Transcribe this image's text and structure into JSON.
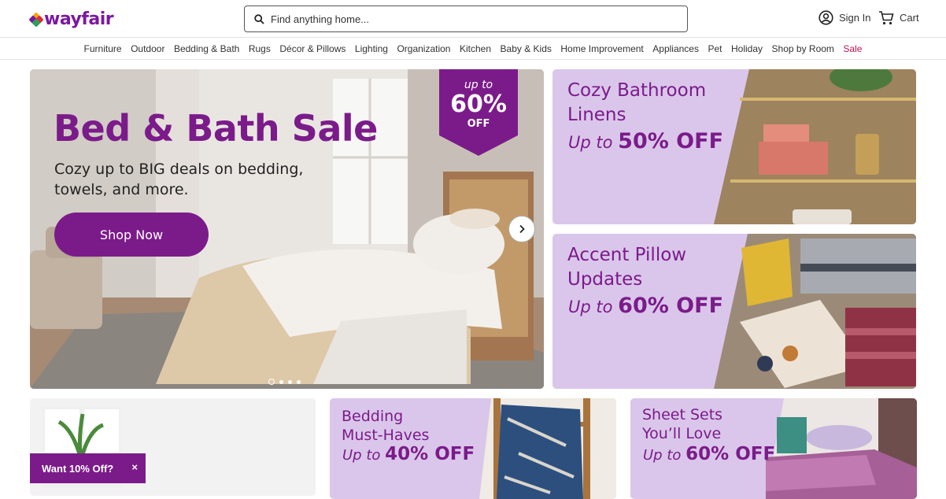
{
  "header": {
    "logo": "wayfair",
    "search_placeholder": "Find anything home...",
    "sign_in": "Sign In",
    "cart": "Cart"
  },
  "nav": {
    "items": [
      "Furniture",
      "Outdoor",
      "Bedding & Bath",
      "Rugs",
      "Décor & Pillows",
      "Lighting",
      "Organization",
      "Kitchen",
      "Baby & Kids",
      "Home Improvement",
      "Appliances",
      "Pet",
      "Holiday",
      "Shop by Room",
      "Sale"
    ]
  },
  "hero": {
    "title": "Bed & Bath Sale",
    "subtitle": "Cozy up to BIG deals on bedding, towels, and more.",
    "cta": "Shop Now",
    "badge_top": "up to",
    "badge_value": "60%",
    "badge_bottom": "OFF",
    "slide_count": 4,
    "active_slide": 1
  },
  "promos": {
    "bathroom": {
      "title_line1": "Cozy Bathroom",
      "title_line2": "Linens",
      "off_prefix": "Up to",
      "off_value": "50% OFF"
    },
    "pillow": {
      "title_line1": "Accent Pillow",
      "title_line2": "Updates",
      "off_prefix": "Up to",
      "off_value": "60% OFF"
    },
    "bedding": {
      "title_line1": "Bedding",
      "title_line2": "Must-Haves",
      "off_prefix": "Up to",
      "off_value": "40% OFF"
    },
    "sheets": {
      "title_line1": "Sheet Sets",
      "title_line2": "You’ll Love",
      "off_prefix": "Up to",
      "off_value": "60% OFF"
    }
  },
  "toast": {
    "label": "Want 10% Off?",
    "close": "×"
  },
  "colors": {
    "brand_purple": "#7b1b8a",
    "promo_lavender": "#dac6ea",
    "sale_red": "#c4134f"
  }
}
